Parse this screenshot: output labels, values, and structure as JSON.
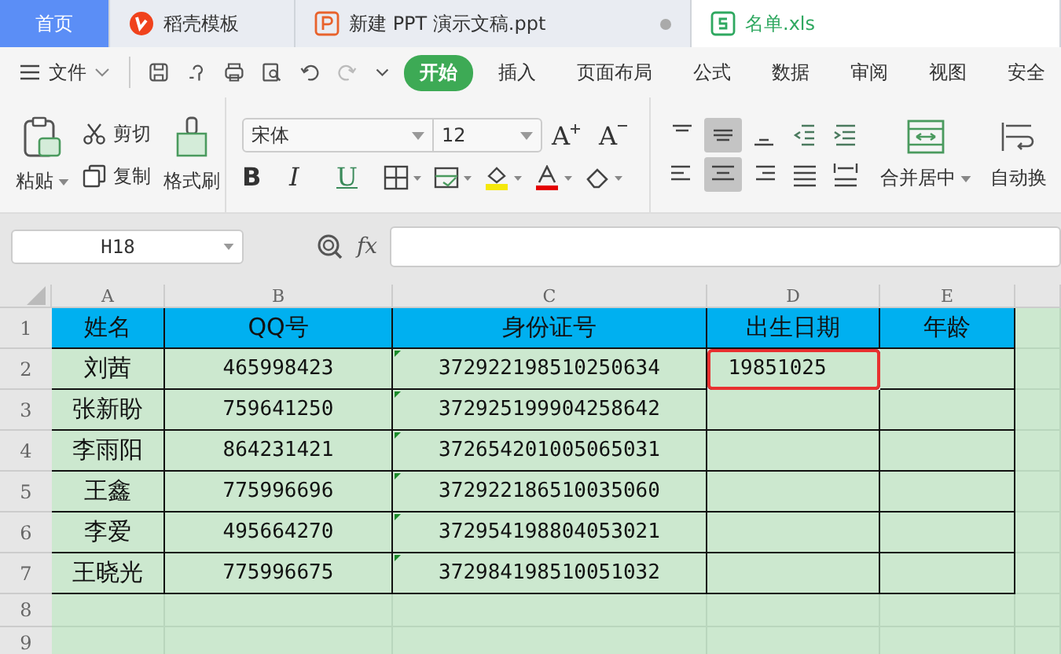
{
  "tabs": [
    {
      "label": "首页",
      "kind": "home",
      "selected": false
    },
    {
      "label": "稻壳模板",
      "kind": "template",
      "selected": false
    },
    {
      "label": "新建 PPT 演示文稿.ppt",
      "kind": "ppt",
      "selected": false
    },
    {
      "label": "名单.xls",
      "kind": "xls",
      "selected": true
    }
  ],
  "menu": {
    "file": "文件",
    "items": [
      {
        "label": "开始",
        "selected": true
      },
      {
        "label": "插入",
        "selected": false
      },
      {
        "label": "页面布局",
        "selected": false
      },
      {
        "label": "公式",
        "selected": false
      },
      {
        "label": "数据",
        "selected": false
      },
      {
        "label": "审阅",
        "selected": false
      },
      {
        "label": "视图",
        "selected": false
      },
      {
        "label": "安全",
        "selected": false
      }
    ]
  },
  "clipboard": {
    "paste": "粘贴",
    "cut": "剪切",
    "copy": "复制",
    "painter": "格式刷"
  },
  "font": {
    "name": "宋体",
    "size": "12",
    "grow": "A",
    "shrink": "A",
    "bold": "B",
    "italic": "I",
    "underline": "U"
  },
  "align_buttons": [
    {
      "kind": "top",
      "selected": false
    },
    {
      "kind": "middle",
      "selected": true
    },
    {
      "kind": "bottom",
      "selected": false
    },
    {
      "kind": "outdent",
      "selected": false
    },
    {
      "kind": "indent",
      "selected": false
    },
    {
      "kind": "left",
      "selected": false
    },
    {
      "kind": "center",
      "selected": true
    },
    {
      "kind": "right",
      "selected": false
    },
    {
      "kind": "justify",
      "selected": false
    },
    {
      "kind": "distribute",
      "selected": false
    }
  ],
  "merge": "合并居中",
  "wrap": "自动换",
  "name_box": "H18",
  "fx": "fx",
  "sheet": {
    "columns": [
      "A",
      "B",
      "C",
      "D",
      "E"
    ],
    "rows": [
      {
        "number": "1",
        "kind": "header",
        "cells": [
          {
            "text": "姓名",
            "selected": false,
            "flagged": false
          },
          {
            "text": "QQ号",
            "selected": false,
            "flagged": false
          },
          {
            "text": "身份证号",
            "selected": false,
            "flagged": false
          },
          {
            "text": "出生日期",
            "selected": false,
            "flagged": false
          },
          {
            "text": "年龄",
            "selected": false,
            "flagged": false
          }
        ]
      },
      {
        "number": "2",
        "kind": "data",
        "cells": [
          {
            "text": "刘茜",
            "selected": false,
            "flagged": false
          },
          {
            "text": "465998423",
            "selected": false,
            "flagged": false
          },
          {
            "text": "372922198510250634",
            "selected": false,
            "flagged": true
          },
          {
            "text": "19851025",
            "selected": true,
            "flagged": false
          },
          {
            "text": "",
            "selected": false,
            "flagged": false
          }
        ]
      },
      {
        "number": "3",
        "kind": "data",
        "cells": [
          {
            "text": "张新盼",
            "selected": false,
            "flagged": false
          },
          {
            "text": "759641250",
            "selected": false,
            "flagged": false
          },
          {
            "text": "372925199904258642",
            "selected": false,
            "flagged": true
          },
          {
            "text": "",
            "selected": false,
            "flagged": false
          },
          {
            "text": "",
            "selected": false,
            "flagged": false
          }
        ]
      },
      {
        "number": "4",
        "kind": "data",
        "cells": [
          {
            "text": "李雨阳",
            "selected": false,
            "flagged": false
          },
          {
            "text": "864231421",
            "selected": false,
            "flagged": false
          },
          {
            "text": "372654201005065031",
            "selected": false,
            "flagged": true
          },
          {
            "text": "",
            "selected": false,
            "flagged": false
          },
          {
            "text": "",
            "selected": false,
            "flagged": false
          }
        ]
      },
      {
        "number": "5",
        "kind": "data",
        "cells": [
          {
            "text": "王鑫",
            "selected": false,
            "flagged": false
          },
          {
            "text": "775996696",
            "selected": false,
            "flagged": false
          },
          {
            "text": "372922186510035060",
            "selected": false,
            "flagged": true
          },
          {
            "text": "",
            "selected": false,
            "flagged": false
          },
          {
            "text": "",
            "selected": false,
            "flagged": false
          }
        ]
      },
      {
        "number": "6",
        "kind": "data",
        "cells": [
          {
            "text": "李爱",
            "selected": false,
            "flagged": false
          },
          {
            "text": "495664270",
            "selected": false,
            "flagged": false
          },
          {
            "text": "372954198804053021",
            "selected": false,
            "flagged": true
          },
          {
            "text": "",
            "selected": false,
            "flagged": false
          },
          {
            "text": "",
            "selected": false,
            "flagged": false
          }
        ]
      },
      {
        "number": "7",
        "kind": "data",
        "cells": [
          {
            "text": "王晓光",
            "selected": false,
            "flagged": false
          },
          {
            "text": "775996675",
            "selected": false,
            "flagged": false
          },
          {
            "text": "372984198510051032",
            "selected": false,
            "flagged": true
          },
          {
            "text": "",
            "selected": false,
            "flagged": false
          },
          {
            "text": "",
            "selected": false,
            "flagged": false
          }
        ]
      },
      {
        "number": "8",
        "kind": "empty",
        "cells": []
      },
      {
        "number": "9",
        "kind": "empty",
        "cells": []
      }
    ]
  }
}
